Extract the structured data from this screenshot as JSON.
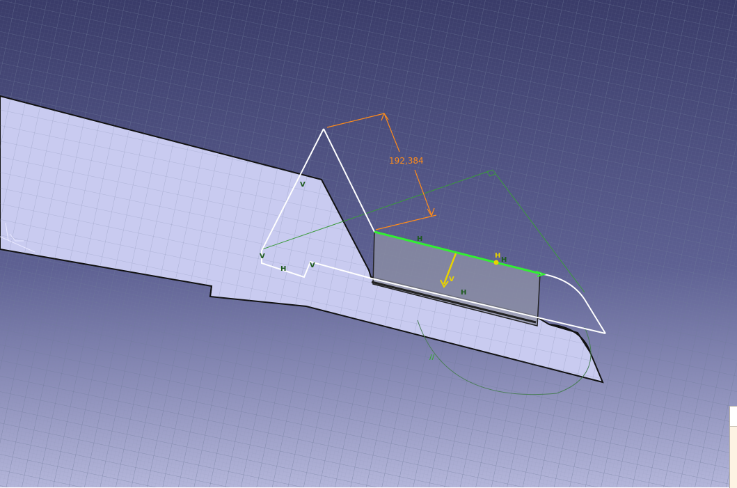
{
  "viewer": {
    "background_top": "#3d3f6d",
    "background_bottom": "#b1b3d8",
    "part_fill": "#c9cbf0",
    "grid_color": "#5d6b8d",
    "sketch_color": "#ffffff",
    "selected_color": "#33ee33",
    "construction_color": "#3a9a3a",
    "dimension_color": "#ff8c1a",
    "axis_color": "#e8d300"
  },
  "dimension": {
    "value": "192,384"
  },
  "constraints": {
    "h_top": "H",
    "h_mid": "H",
    "h_sub": "H",
    "h_low": "H",
    "h_left": "H",
    "v_left_top": "V",
    "v_left_bottom": "V",
    "v_inner": "V",
    "v_axis": "V",
    "parallel": "//"
  }
}
